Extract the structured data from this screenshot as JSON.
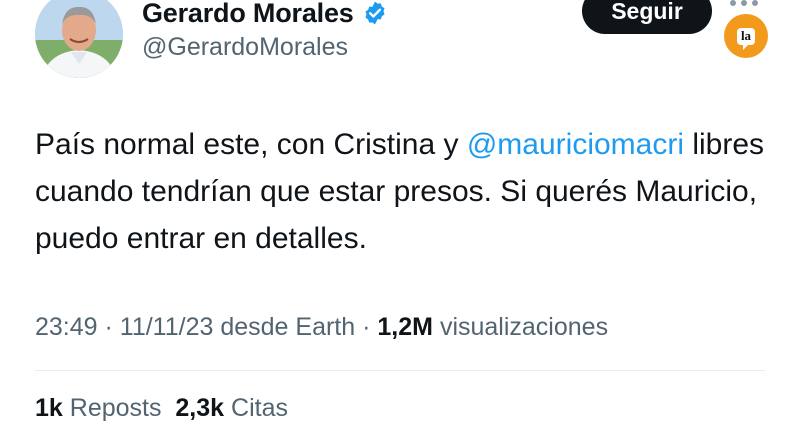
{
  "author": {
    "display_name": "Gerardo Morales",
    "handle": "@GerardoMorales",
    "verified": true
  },
  "follow_button": {
    "label": "Seguir"
  },
  "badge": {
    "text": "la",
    "color": "#f39a1c"
  },
  "tweet": {
    "text_before": "País normal este, con Cristina y ",
    "mention": "@mauriciomacri",
    "text_after": " libres cuando tendrían que estar presos. Si querés Mauricio, puedo entrar en detalles."
  },
  "meta": {
    "time": "23:49",
    "date": "11/11/23",
    "source": "desde Earth",
    "views_count": "1,2M",
    "views_label": "visualizaciones"
  },
  "stats": {
    "reposts_count": "1k",
    "reposts_label": "Reposts",
    "quotes_count": "2,3k",
    "quotes_label": "Citas"
  },
  "colors": {
    "link": "#1d9bf0",
    "muted": "#536471",
    "text": "#0f1419",
    "verified": "#1d9bf0"
  }
}
